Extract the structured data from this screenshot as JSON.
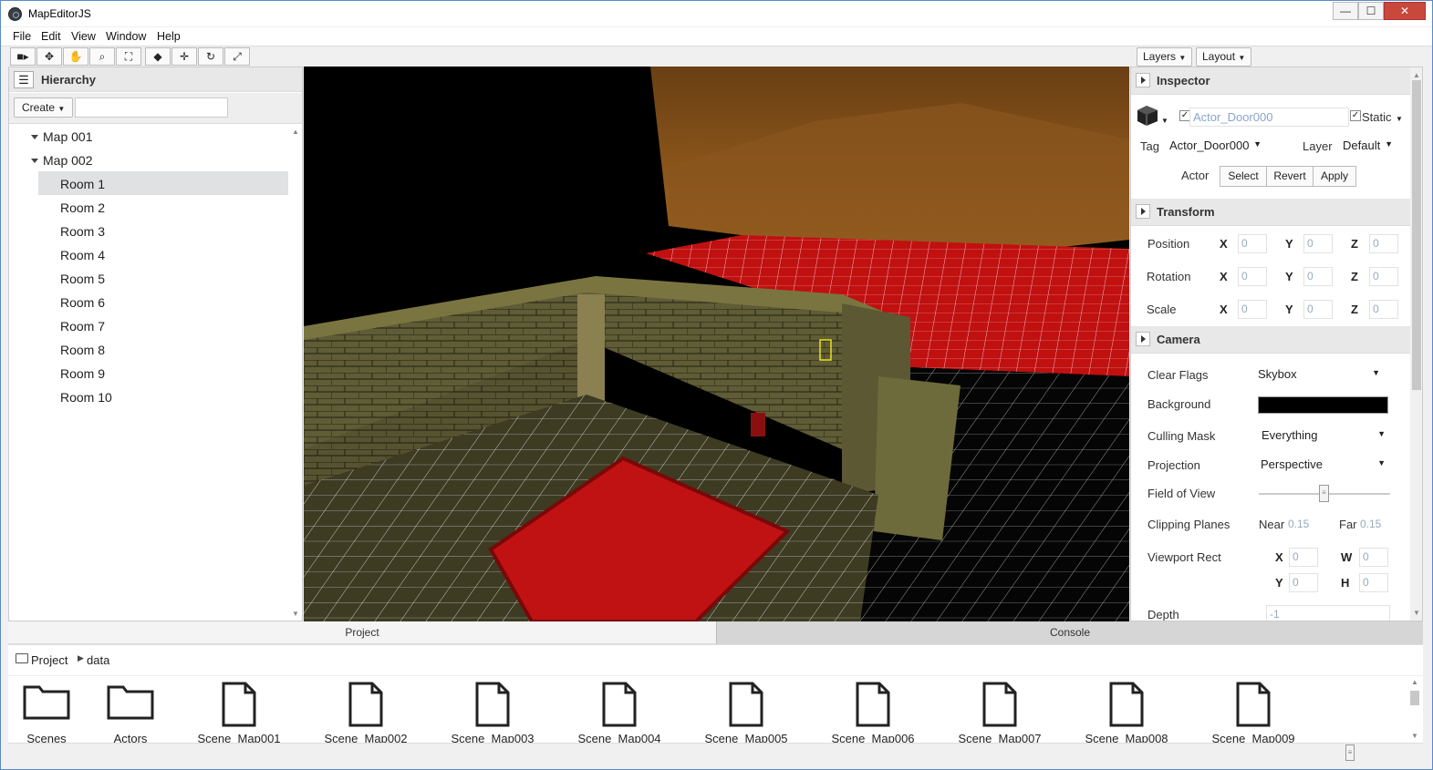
{
  "app": {
    "title": "MapEditorJS"
  },
  "window_controls": {
    "minimize": "—",
    "maximize": "☐",
    "close": "✕"
  },
  "menu": [
    "File",
    "Edit",
    "View",
    "Window",
    "Help"
  ],
  "toolbar": {
    "icons": [
      "video-camera-icon",
      "move-icon",
      "hand-icon",
      "zoom-icon",
      "fit-icon",
      "cube-icon",
      "translate-icon",
      "rotate-icon",
      "expand-icon"
    ],
    "layers_label": "Layers",
    "layout_label": "Layout"
  },
  "hierarchy": {
    "title": "Hierarchy",
    "create_label": "Create",
    "search_value": "",
    "tree": [
      {
        "label": "Map 001",
        "children": []
      },
      {
        "label": "Map 002",
        "children": [
          "Room 1",
          "Room 2",
          "Room 3",
          "Room 4",
          "Room 5",
          "Room 6",
          "Room 7",
          "Room 8",
          "Room 9",
          "Room 10"
        ]
      }
    ],
    "selected": "Room 1"
  },
  "inspector": {
    "title": "Inspector",
    "object_name": "Actor_Door000",
    "active_checked": true,
    "static_label": "Static",
    "static_checked": true,
    "tag_label": "Tag",
    "tag_value": "Actor_Door000",
    "layer_label": "Layer",
    "layer_value": "Default",
    "actor_label": "Actor",
    "select_btn": "Select",
    "revert_btn": "Revert",
    "apply_btn": "Apply",
    "transform": {
      "title": "Transform",
      "rows": [
        {
          "label": "Position",
          "x": "0",
          "y": "0",
          "z": "0"
        },
        {
          "label": "Rotation",
          "x": "0",
          "y": "0",
          "z": "0"
        },
        {
          "label": "Scale",
          "x": "0",
          "y": "0",
          "z": "0"
        }
      ],
      "axes": [
        "X",
        "Y",
        "Z"
      ]
    },
    "camera": {
      "title": "Camera",
      "clear_flags_label": "Clear Flags",
      "clear_flags_value": "Skybox",
      "background_label": "Background",
      "background_color": "#000000",
      "culling_mask_label": "Culling Mask",
      "culling_mask_value": "Everything",
      "projection_label": "Projection",
      "projection_value": "Perspective",
      "fov_label": "Field of View",
      "fov_slider": 0.5,
      "clipping_label": "Clipping Planes",
      "near_label": "Near",
      "near_value": "0.15",
      "far_label": "Far",
      "far_value": "0.15",
      "viewport_label": "Viewport Rect",
      "vp_x_label": "X",
      "vp_x": "0",
      "vp_w_label": "W",
      "vp_w": "0",
      "vp_y_label": "Y",
      "vp_y": "0",
      "vp_h_label": "H",
      "vp_h": "0",
      "depth_label": "Depth",
      "depth_value": "-1"
    }
  },
  "bottom": {
    "tabs": [
      "Project",
      "Console"
    ],
    "active_tab": "Project",
    "breadcrumb": [
      "Project",
      "data"
    ],
    "assets": [
      {
        "name": "Scenes",
        "type": "folder"
      },
      {
        "name": "Actors",
        "type": "folder"
      },
      {
        "name": "Scene_Map001",
        "type": "file"
      },
      {
        "name": "Scene_Map002",
        "type": "file"
      },
      {
        "name": "Scene_Map003",
        "type": "file"
      },
      {
        "name": "Scene_Map004",
        "type": "file"
      },
      {
        "name": "Scene_Map005",
        "type": "file"
      },
      {
        "name": "Scene_Map006",
        "type": "file"
      },
      {
        "name": "Scene_Map007",
        "type": "file"
      },
      {
        "name": "Scene_Map008",
        "type": "file"
      },
      {
        "name": "Scene_Map009",
        "type": "file"
      }
    ]
  },
  "colors": {
    "accent_red": "#d01010",
    "wall": "#6b6a3a",
    "ceiling": "#8a5a1c",
    "selection": "#dfe1e3"
  }
}
